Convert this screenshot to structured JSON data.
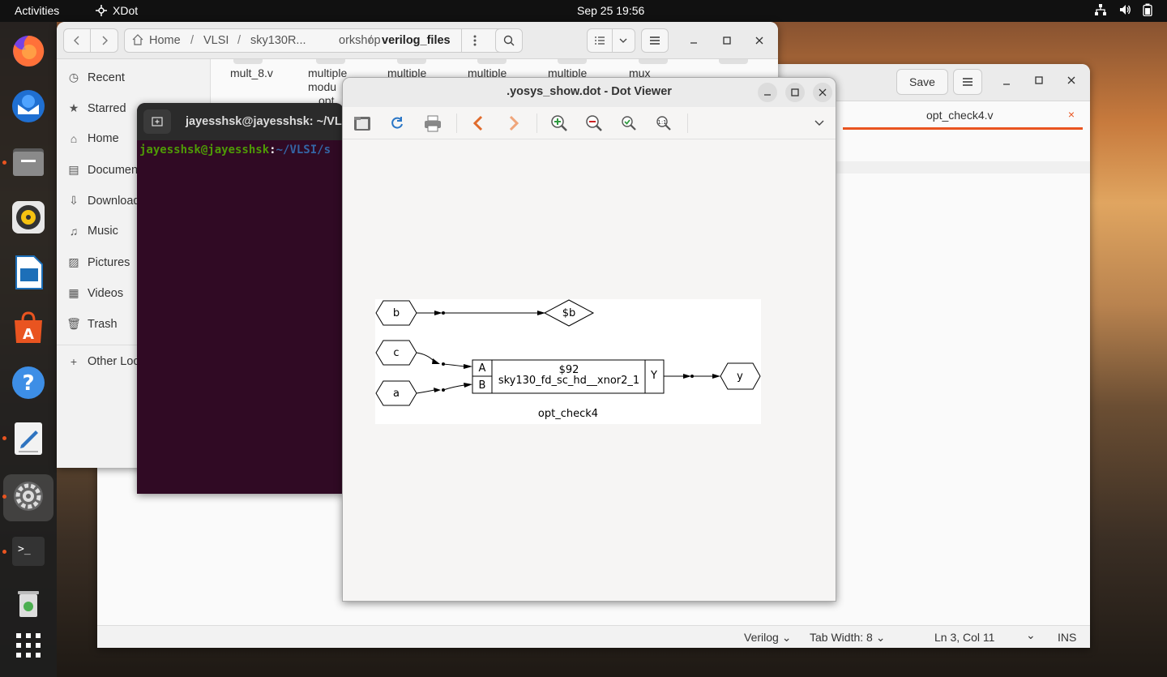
{
  "topbar": {
    "activities": "Activities",
    "app_name": "XDot",
    "clock": "Sep 25  19:56"
  },
  "files_window": {
    "breadcrumb": [
      "Home",
      "VLSI",
      "sky130R...",
      "orkshop",
      "verilog_files"
    ],
    "sidebar": [
      "Recent",
      "Starred",
      "Home",
      "Documen",
      "Download",
      "Music",
      "Pictures",
      "Videos",
      "Trash",
      "Other Loc"
    ],
    "files": [
      "mult_8.v",
      "multiple",
      "multiple",
      "multiple",
      "multiple",
      "mux"
    ],
    "file_extra_1": "modu",
    "file_extra_2": "opt"
  },
  "editor_window": {
    "save_label": "Save",
    "tab_label": "opt_check4.v",
    "statusbar": {
      "language": "Verilog",
      "tab_width": "Tab Width: 8",
      "position": "Ln 3, Col 11",
      "mode": "INS"
    }
  },
  "terminal_window": {
    "title": "jayesshsk@jayesshsk: ~/VL",
    "prompt_user": "jayesshsk@jayesshsk",
    "prompt_sep": ":",
    "prompt_path": "~/VLSI/s"
  },
  "dot_viewer": {
    "title": ".yosys_show.dot - Dot Viewer",
    "graph": {
      "nodes": {
        "b": "b",
        "b_out": "$b",
        "c": "c",
        "a": "a",
        "y": "y",
        "cell_id": "$92",
        "cell_type": "sky130_fd_sc_hd__xnor2_1",
        "port_a": "A",
        "port_b": "B",
        "port_y": "Y"
      },
      "label": "opt_check4"
    }
  },
  "colors": {
    "accent": "#e95420",
    "terminal_bg": "#300a24",
    "prompt_user": "#4e9a06",
    "prompt_path": "#3465a4"
  }
}
